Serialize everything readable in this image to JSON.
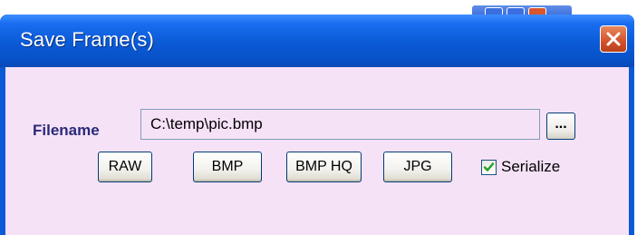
{
  "dialog": {
    "title": "Save Frame(s)",
    "close_icon": "close-icon"
  },
  "form": {
    "filename_label": "Filename",
    "filename_value": "C:\\temp\\pic.bmp",
    "browse_label": "..."
  },
  "formats": {
    "raw_label": "RAW",
    "bmp_label": "BMP",
    "bmphq_label": "BMP HQ",
    "jpg_label": "JPG"
  },
  "serialize": {
    "label": "Serialize",
    "checked": true,
    "check_icon": "checkmark-icon"
  },
  "colors": {
    "titlebar": "#0a5ad6",
    "client_background": "#f6e2f6",
    "label_text": "#2a2a7a",
    "close_button": "#d2522a",
    "checkmark": "#21a121"
  }
}
